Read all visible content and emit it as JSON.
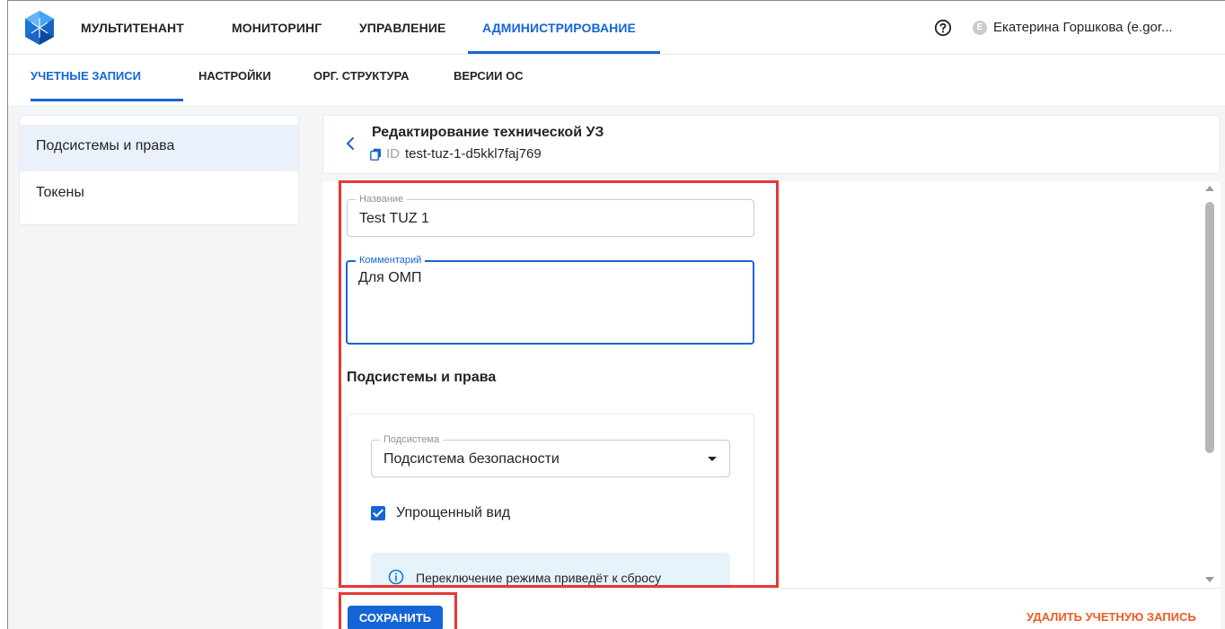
{
  "topnav": {
    "items": [
      "МУЛЬТИТЕНАНТ",
      "МОНИТОРИНГ",
      "УПРАВЛЕНИЕ",
      "АДМИНИСТРИРОВАНИЕ"
    ],
    "active": "АДМИНИСТРИРОВАНИЕ",
    "user": {
      "avatar_letter": "E",
      "name": "Екатерина Горшкова (e.gor..."
    }
  },
  "subnav": {
    "items": [
      "УЧЕТНЫЕ ЗАПИСИ",
      "НАСТРОЙКИ",
      "ОРГ. СТРУКТУРА",
      "ВЕРСИИ ОС"
    ],
    "active": "УЧЕТНЫЕ ЗАПИСИ"
  },
  "sidemenu": {
    "items": [
      "Подсистемы и права",
      "Токены"
    ],
    "selected": "Подсистемы и права"
  },
  "header": {
    "title": "Редактирование технической УЗ",
    "id_label": "ID",
    "id_value": "test-tuz-1-d5kkl7faj769"
  },
  "form": {
    "name_label": "Название",
    "name_value": "Test TUZ 1",
    "comment_label": "Комментарий",
    "comment_value": "Для ОМП",
    "section_title": "Подсистемы и права",
    "subsystem_label": "Подсистема",
    "subsystem_value": "Подсистема безопасности",
    "simplified_view_label": "Упрощенный вид",
    "simplified_view_checked": true,
    "info_text": "Переключение режима приведёт к сбросу"
  },
  "footer": {
    "save_label": "СОХРАНИТЬ",
    "delete_label": "УДАЛИТЬ УЧЕТНУЮ ЗАПИСЬ"
  },
  "colors": {
    "accent": "#1565d8",
    "highlight": "#e53935",
    "danger": "#f05a23",
    "info_bg": "#e6f3fa",
    "selected_bg": "#ebf1fa"
  },
  "icons": [
    "app-logo-icon",
    "help-circle-icon",
    "chevron-left-icon",
    "copy-icon",
    "caret-down-icon",
    "checkbox-checked-icon",
    "info-circle-icon"
  ]
}
